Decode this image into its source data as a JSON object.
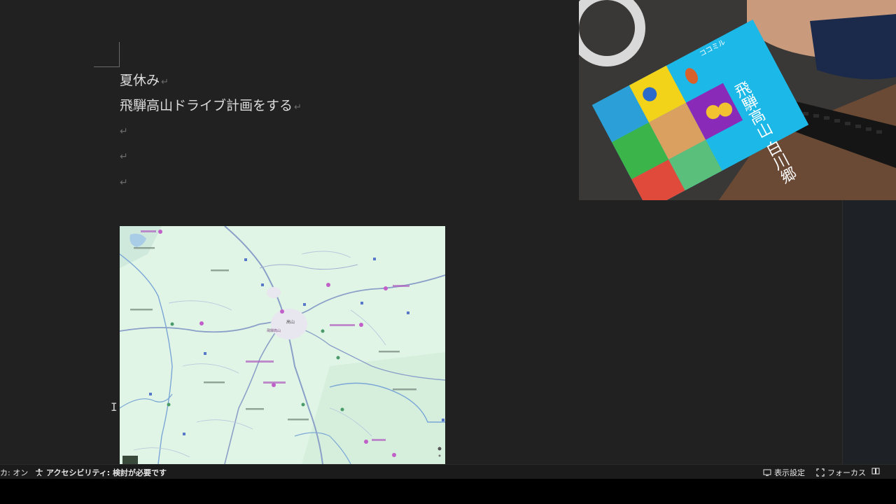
{
  "document": {
    "paragraphs": [
      {
        "text": "夏休み"
      },
      {
        "text": "飛騨高山ドライブ計画をする"
      }
    ],
    "paragraph_mark": "↵",
    "cursor": "I"
  },
  "map": {
    "place_labels": [
      "高山",
      "飛騨高山"
    ]
  },
  "webcam": {
    "book_title_vertical": "飛騨高山 白川郷",
    "book_series": "ココミル"
  },
  "statusbar": {
    "left_fragment": "カ: オン",
    "accessibility": "アクセシビリティ: 検討が必要です",
    "display_settings": "表示設定",
    "focus": "フォーカス"
  },
  "colors": {
    "background": "#212121",
    "text": "#dcdcdc",
    "paragraph_mark": "#6b6b6b",
    "map_land": "#dff4e4",
    "map_road": "#8aa0c8",
    "book_cyan": "#1cb8e8"
  },
  "icons": [
    "accessibility-icon",
    "display-settings-icon",
    "focus-icon",
    "read-mode-icon"
  ]
}
